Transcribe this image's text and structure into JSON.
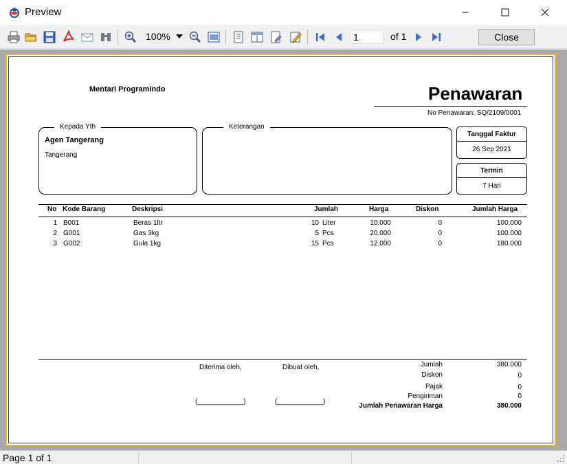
{
  "window": {
    "title": "Preview"
  },
  "toolbar": {
    "zoom": "100%",
    "page_current": "1",
    "page_of": "of 1",
    "close_label": "Close",
    "icons": [
      "printer-icon",
      "open-folder-icon",
      "save-icon",
      "pdf-icon",
      "mail-icon",
      "find-icon",
      "zoom-in-icon",
      "zoom-out-icon",
      "page-width-icon",
      "single-page-icon",
      "two-page-icon",
      "page-setup-icon",
      "edit-icon",
      "first-page-icon",
      "prev-page-icon",
      "next-page-icon",
      "last-page-icon"
    ]
  },
  "document": {
    "company": "Mentari Programindo",
    "title": "Penawaran",
    "number_line": "No Penawaran: SQ/2109/0001",
    "to": {
      "legend": "Kepada Yth",
      "name": "Agen Tangerang",
      "address": "Tangerang"
    },
    "notes": {
      "legend": "Keterangan"
    },
    "invoice_date": {
      "label": "Tanggal Faktur",
      "value": "26 Sep 2021"
    },
    "terms": {
      "label": "Termin",
      "value": "7 Hari"
    },
    "columns": {
      "no": "No",
      "code": "Kode Barang",
      "desc": "Deskripsi",
      "qty": "Jumlah",
      "price": "Harga",
      "discount": "Diskon",
      "total": "Jumlah Harga"
    },
    "rows": [
      {
        "no": "1",
        "code": "B001",
        "desc": "Beras 1ltr",
        "qty": "10",
        "unit": "Liter",
        "price": "10.000",
        "discount": "0",
        "total": "100.000"
      },
      {
        "no": "2",
        "code": "G001",
        "desc": "Gas 3kg",
        "qty": "5",
        "unit": "Pcs",
        "price": "20.000",
        "discount": "0",
        "total": "100.000"
      },
      {
        "no": "3",
        "code": "G002",
        "desc": "Gula 1kg",
        "qty": "15",
        "unit": "Pcs",
        "price": "12.000",
        "discount": "0",
        "total": "180.000"
      }
    ],
    "received_by": "Diterima oleh,",
    "made_by": "Dibuat oleh,",
    "sign_blank": "(____________)",
    "summary": {
      "subtotal_label": "Jumlah",
      "subtotal": "380.000",
      "discount_label": "Diskon",
      "discount": "0",
      "tax_label": "Pajak",
      "tax": "0",
      "shipping_label": "Pengiriman",
      "shipping": "0",
      "grand_label": "Jumlah Penawaran Harga",
      "grand": "380.000"
    }
  },
  "status": {
    "text": "Page 1 of 1"
  }
}
